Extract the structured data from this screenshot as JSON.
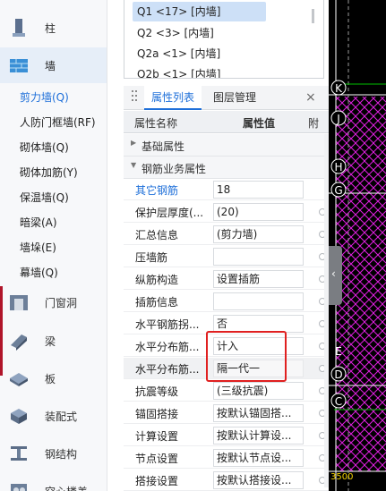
{
  "sidebar": {
    "categories": [
      {
        "label": "柱",
        "icon": "column-icon"
      },
      {
        "label": "墙",
        "icon": "wall-icon"
      },
      {
        "label": "门窗洞",
        "icon": "door-window-icon"
      },
      {
        "label": "梁",
        "icon": "beam-icon"
      },
      {
        "label": "板",
        "icon": "slab-icon"
      },
      {
        "label": "装配式",
        "icon": "prefab-icon"
      },
      {
        "label": "钢结构",
        "icon": "steel-structure-icon"
      },
      {
        "label": "空心楼盖",
        "icon": "hollow-floor-icon"
      }
    ],
    "wall_items": [
      {
        "label": "剪力墙(Q)"
      },
      {
        "label": "人防门框墙(RF)"
      },
      {
        "label": "砌体墙(Q)"
      },
      {
        "label": "砌体加筋(Y)"
      },
      {
        "label": "保温墙(Q)"
      },
      {
        "label": "暗梁(A)"
      },
      {
        "label": "墙垛(E)"
      },
      {
        "label": "幕墙(Q)"
      }
    ]
  },
  "floor_list": [
    {
      "label": "Q1 <17> [内墙]"
    },
    {
      "label": "Q2 <3> [内墙]"
    },
    {
      "label": "Q2a <1> [内墙]"
    },
    {
      "label": "Q2b <1> [内墙]"
    }
  ],
  "panel": {
    "tab_properties": "属性列表",
    "tab_layers": "图层管理",
    "close": "×",
    "col_name": "属性名称",
    "col_value": "属性值",
    "col_extra": "附",
    "group_basic": "基础属性",
    "group_rebar": "钢筋业务属性"
  },
  "properties": [
    {
      "name": "其它钢筋",
      "value": "18",
      "blue": true
    },
    {
      "name": "保护层厚度(...",
      "value": "(20)"
    },
    {
      "name": "汇总信息",
      "value": "(剪力墙)"
    },
    {
      "name": "压墙筋",
      "value": ""
    },
    {
      "name": "纵筋构造",
      "value": "设置插筋"
    },
    {
      "name": "插筋信息",
      "value": ""
    },
    {
      "name": "水平钢筋拐...",
      "value": "否"
    },
    {
      "name": "水平分布筋...",
      "value": "计入"
    },
    {
      "name": "水平分布筋...",
      "value": "隔一代一"
    },
    {
      "name": "抗震等级",
      "value": "(三级抗震)"
    },
    {
      "name": "锚固搭接",
      "value": "按默认锚固搭..."
    },
    {
      "name": "计算设置",
      "value": "按默认计算设..."
    },
    {
      "name": "节点设置",
      "value": "按默认节点设..."
    },
    {
      "name": "搭接设置",
      "value": "按默认搭接设..."
    }
  ],
  "cad": {
    "grid_labels": [
      "K",
      "J",
      "H",
      "G",
      "E",
      "D",
      "C"
    ],
    "dimension": "3500",
    "colors": {
      "background": "#000000",
      "hatch": "#ff00ff",
      "grid": "#ffffff",
      "axis": "#00ff00"
    }
  }
}
